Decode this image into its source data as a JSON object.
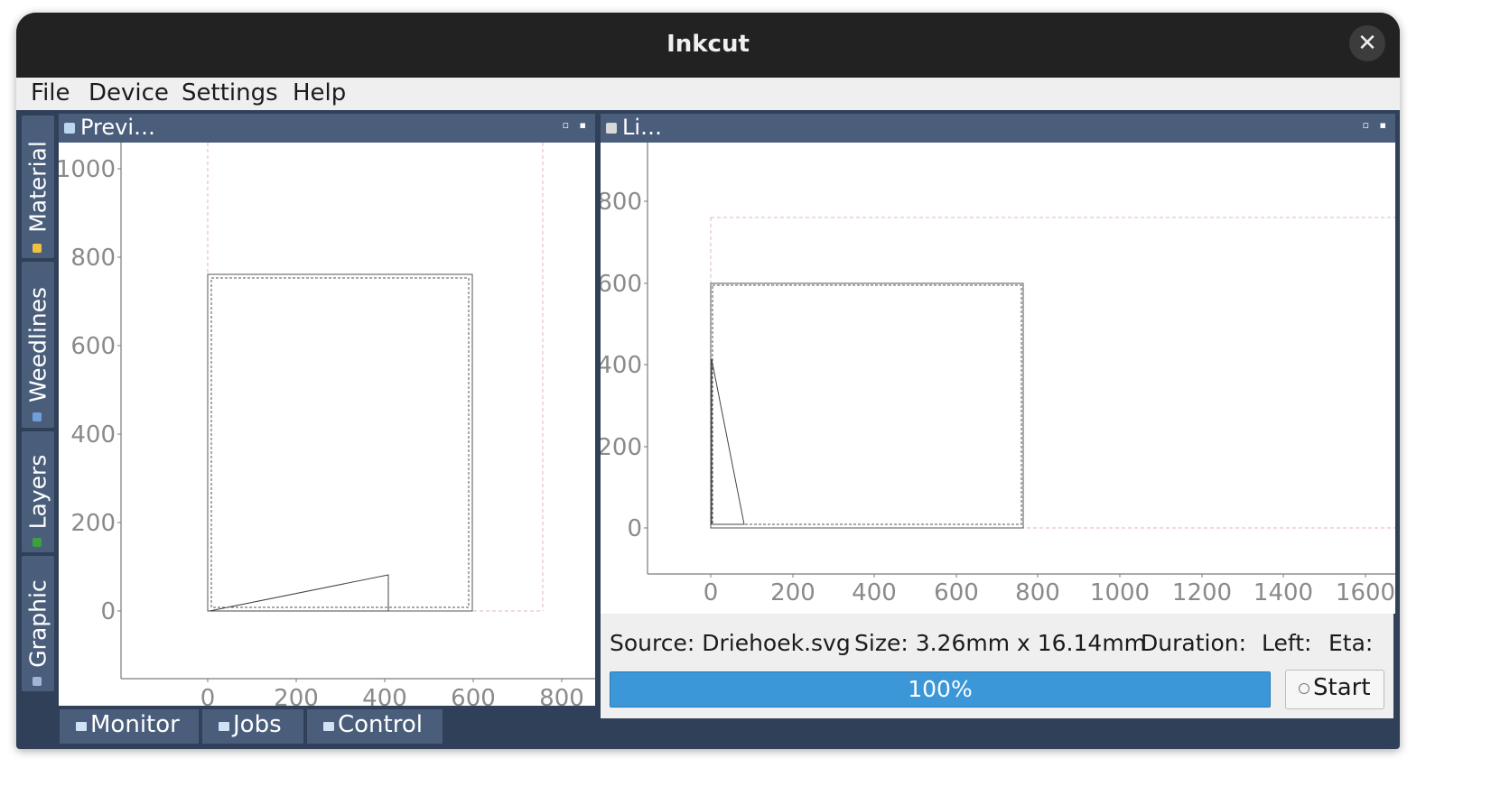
{
  "window": {
    "title": "Inkcut"
  },
  "menu": [
    "File",
    "Device",
    "Settings",
    "Help"
  ],
  "side_tabs": [
    {
      "label": "Material",
      "icon": "material-icon",
      "color": "#f0c040"
    },
    {
      "label": "Weedlines",
      "icon": "weedlines-icon",
      "color": "#6fa0d8"
    },
    {
      "label": "Layers",
      "icon": "layers-icon",
      "color": "#3aa040"
    },
    {
      "label": "Graphic",
      "icon": "graphic-icon",
      "color": "#9fb6d6"
    }
  ],
  "preview_dock": {
    "title": "Previ…",
    "icon": "preview-icon"
  },
  "live_dock": {
    "title": "Li…",
    "icon": "printer-icon"
  },
  "preview_plot": {
    "y_ticks": [
      "1000",
      "800",
      "600",
      "400",
      "200",
      "0"
    ],
    "x_ticks": [
      "0",
      "200",
      "400",
      "600",
      "800"
    ]
  },
  "live_plot": {
    "y_ticks": [
      "800",
      "600",
      "400",
      "200",
      "0"
    ],
    "x_ticks": [
      "0",
      "200",
      "400",
      "600",
      "800",
      "1000",
      "1200",
      "1400",
      "1600"
    ]
  },
  "status": {
    "source": "Source: Driehoek.svg",
    "size": "Size: 3.26mm x 16.14mm",
    "duration": "Duration:",
    "left": "Left:",
    "eta": "Eta:"
  },
  "progress": {
    "value": 100,
    "label": "100%"
  },
  "start_button": {
    "label": "Start"
  },
  "bottom_tabs": [
    {
      "label": "Monitor",
      "icon": "monitor-icon"
    },
    {
      "label": "Jobs",
      "icon": "jobs-icon"
    },
    {
      "label": "Control",
      "icon": "control-icon"
    }
  ],
  "colors": {
    "panel": "#4a5e7c",
    "frame": "#2f4058",
    "progress": "#3c97d8",
    "grid_dash": "#e3b4bc"
  }
}
